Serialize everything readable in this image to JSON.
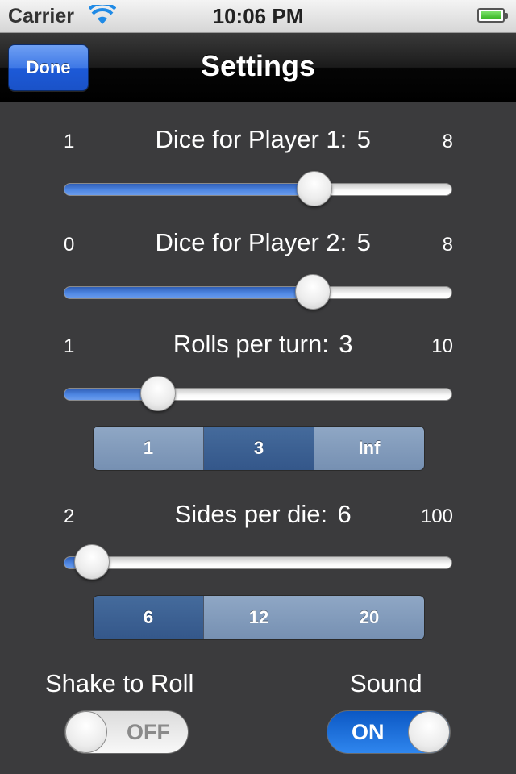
{
  "status_bar": {
    "carrier": "Carrier",
    "time": "10:06 PM"
  },
  "nav": {
    "done_label": "Done",
    "title": "Settings"
  },
  "sliders": [
    {
      "label": "Dice for Player 1:",
      "value": "5",
      "min": "1",
      "max": "8",
      "fraction": 0.645
    },
    {
      "label": "Dice for Player 2:",
      "value": "5",
      "min": "0",
      "max": "8",
      "fraction": 0.642
    },
    {
      "label": "Rolls per turn:",
      "value": "3",
      "min": "1",
      "max": "10",
      "fraction": 0.243
    },
    {
      "label": "Sides per die:",
      "value": "6",
      "min": "2",
      "max": "100",
      "fraction": 0.073
    }
  ],
  "rolls_segments": {
    "options": [
      "1",
      "3",
      "Inf"
    ],
    "selected": "3"
  },
  "sides_segments": {
    "options": [
      "6",
      "12",
      "20"
    ],
    "selected": "6"
  },
  "toggles": {
    "shake": {
      "label": "Shake to Roll",
      "state": "OFF"
    },
    "sound": {
      "label": "Sound",
      "state": "ON"
    }
  },
  "colors": {
    "accent": "#4f87e3",
    "nav_button": "#2a63d8",
    "background": "#3b3b3d"
  }
}
